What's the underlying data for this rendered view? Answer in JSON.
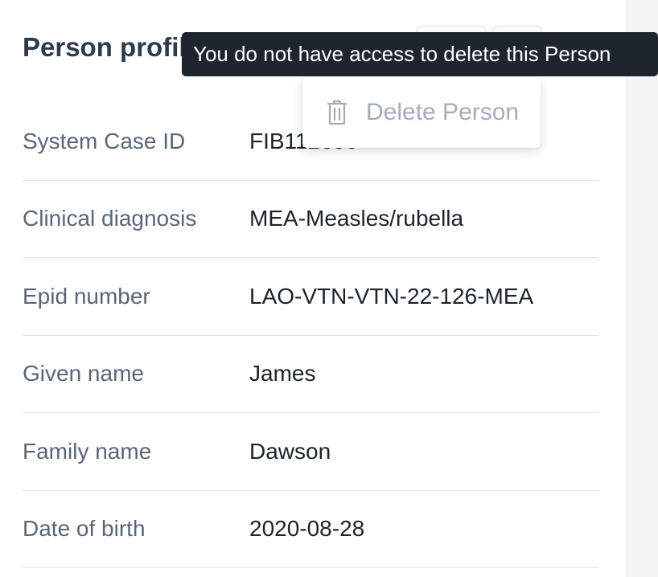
{
  "profile": {
    "title": "Person profile"
  },
  "fields": [
    {
      "label": "System Case ID",
      "value": "FIB112600"
    },
    {
      "label": "Clinical diagnosis",
      "value": "MEA-Measles/rubella"
    },
    {
      "label": "Epid number",
      "value": "LAO-VTN-VTN-22-126-MEA"
    },
    {
      "label": "Given name",
      "value": "James"
    },
    {
      "label": "Family name",
      "value": "Dawson"
    },
    {
      "label": "Date of birth",
      "value": "2020-08-28"
    }
  ],
  "menu": {
    "delete_label": "Delete Person",
    "delete_icon": "trash-icon",
    "disabled": true
  },
  "tooltip": {
    "text": "You do not have access to delete this Person"
  },
  "colors": {
    "tooltip_bg": "#1f252e",
    "disabled_text": "#a4adba",
    "label_text": "#5a6677",
    "value_text": "#1d232c",
    "title_text": "#2f3a4a"
  }
}
